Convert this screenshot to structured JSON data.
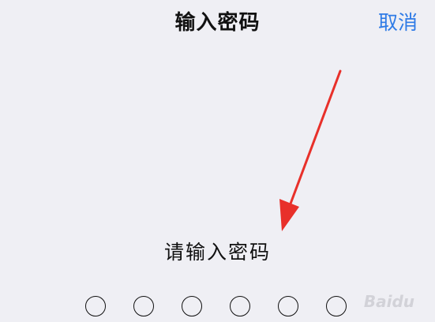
{
  "header": {
    "title": "输入密码",
    "cancel_label": "取消"
  },
  "main": {
    "prompt": "请输入密码",
    "passcode_length": 6,
    "entered_digits": 0
  },
  "watermark": {
    "text": "Baidu"
  },
  "colors": {
    "background": "#efeff4",
    "accent": "#2f7be6",
    "annotation_arrow": "#e8302a",
    "text": "#111111"
  }
}
